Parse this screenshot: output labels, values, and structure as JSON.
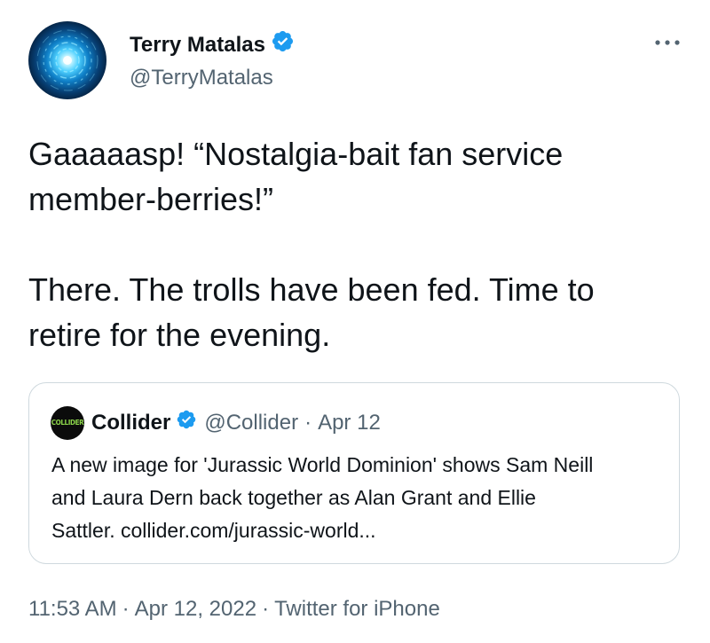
{
  "author": {
    "display_name": "Terry Matalas",
    "handle": "@TerryMatalas",
    "verified": true,
    "avatar_icon": "circular-light-avatar"
  },
  "menu_icon": "more-horizontal-icon",
  "tweet": {
    "lines_para1": [
      "Gaaaaasp! “Nostalgia-bait fan service",
      "member-berries!”"
    ],
    "lines_para2": [
      "There. The trolls have been fed. Time to",
      "retire for the evening."
    ]
  },
  "quote": {
    "avatar_text": "COLLIDER",
    "display_name": "Collider",
    "verified": true,
    "handle": "@Collider",
    "separator": "·",
    "date": "Apr 12",
    "lines": [
      "A new image for 'Jurassic World Dominion' shows Sam Neill",
      "and Laura Dern back together as Alan Grant and Ellie",
      "Sattler. collider.com/jurassic-world..."
    ]
  },
  "footer": {
    "time": "11:53 AM",
    "separator": "·",
    "date": "Apr 12, 2022",
    "source": "Twitter for iPhone"
  },
  "colors": {
    "text": "#0f1419",
    "secondary": "#536471",
    "verified_blue": "#1d9bf0",
    "border": "#cfd9de"
  }
}
